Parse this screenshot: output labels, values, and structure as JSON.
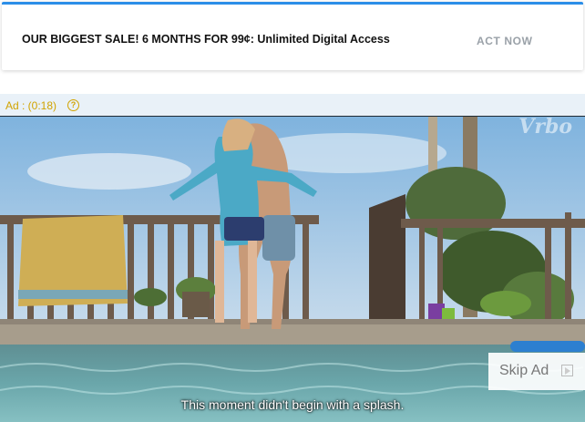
{
  "promo": {
    "headline": "OUR BIGGEST SALE! 6 MONTHS FOR 99¢: Unlimited Digital Access",
    "cta_label": "ACT NOW"
  },
  "ad": {
    "label": "Ad : (0:18)",
    "help_icon": "?"
  },
  "video": {
    "brand_watermark": "Vrbo",
    "caption": "This moment didn't begin with a splash.",
    "skip_label": "Skip Ad",
    "skip_icon": "skip-next-icon"
  },
  "colors": {
    "accent_bar": "#2b8ee8",
    "ad_label": "#d1a300",
    "cta": "#9aa1a8"
  }
}
